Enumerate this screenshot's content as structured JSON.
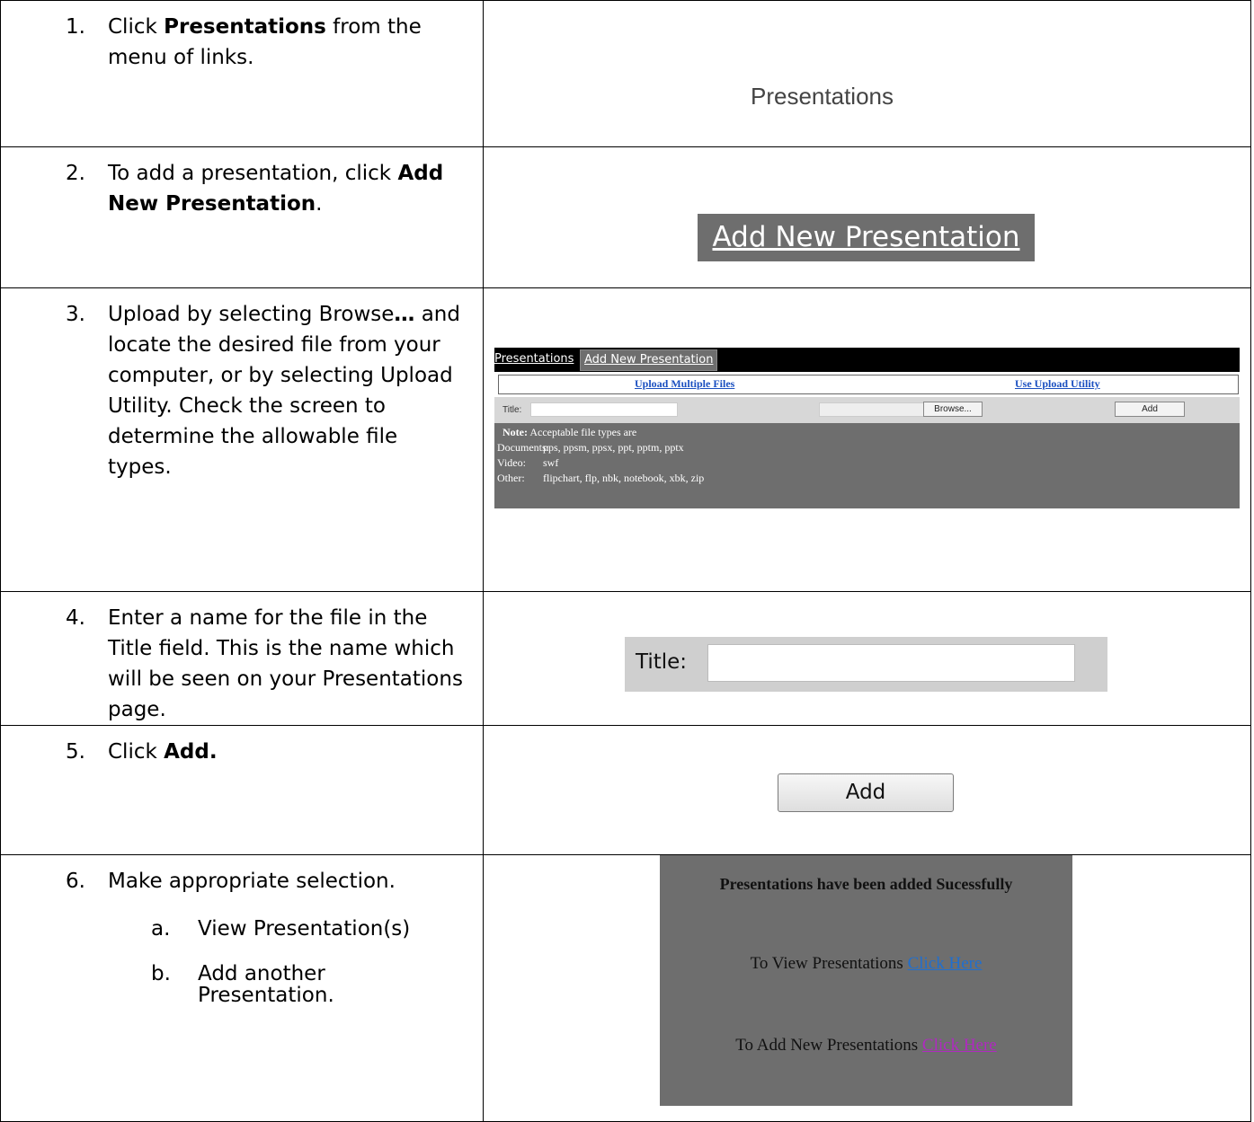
{
  "steps": [
    {
      "num": "1.",
      "pre": "Click ",
      "bold": "Presentations",
      "post": " from the menu of links."
    },
    {
      "num": "2.",
      "pre": "To add a presentation, click ",
      "bold": "Add New Presentation",
      "post": "."
    },
    {
      "num": "3.",
      "pre": "Upload by selecting Browse",
      "bold": "…",
      "post": " and locate the desired file from your computer, or by selecting Upload Utility.  Check the screen to determine the allowable file types."
    },
    {
      "num": "4.",
      "pre": "Enter a name for the file in the Title field. This is the name which will be seen on your Presentations page.",
      "bold": "",
      "post": ""
    },
    {
      "num": "5.",
      "pre": "Click ",
      "bold": "Add.",
      "post": ""
    },
    {
      "num": "6.",
      "pre": "Make appropriate selection.",
      "bold": "",
      "post": ""
    }
  ],
  "substeps": [
    {
      "letter": "a.",
      "text": "View Presentation(s)"
    },
    {
      "letter": "b.",
      "text": "Add another Presentation."
    }
  ],
  "img1": {
    "label": "Presentations"
  },
  "img2": {
    "button": "Add New Presentation"
  },
  "img3": {
    "tab_presentations": "Presentations",
    "tab_add": "Add New Presentation",
    "link_multiple": "Upload Multiple Files",
    "link_utility": "Use Upload Utility",
    "title_label": "Title:",
    "browse_button": "Browse...",
    "add_button": "Add",
    "note_bold": "Note:",
    "note_text": " Acceptable file types are",
    "types": [
      {
        "k": "Documents:",
        "v": "pps, ppsm, ppsx, ppt, pptm, pptx"
      },
      {
        "k": "Video:",
        "v": "swf"
      },
      {
        "k": "Other:",
        "v": "flipchart, flp, nbk, notebook, xbk, zip"
      }
    ]
  },
  "img4": {
    "title_label": "Title:"
  },
  "img5": {
    "add_button": "Add"
  },
  "img6": {
    "heading": "Presentations have been added Sucessfully",
    "view_text": "To View Presentations ",
    "view_link": "Click Here",
    "add_text": "To Add New Presentations ",
    "add_link": "Click Here"
  }
}
